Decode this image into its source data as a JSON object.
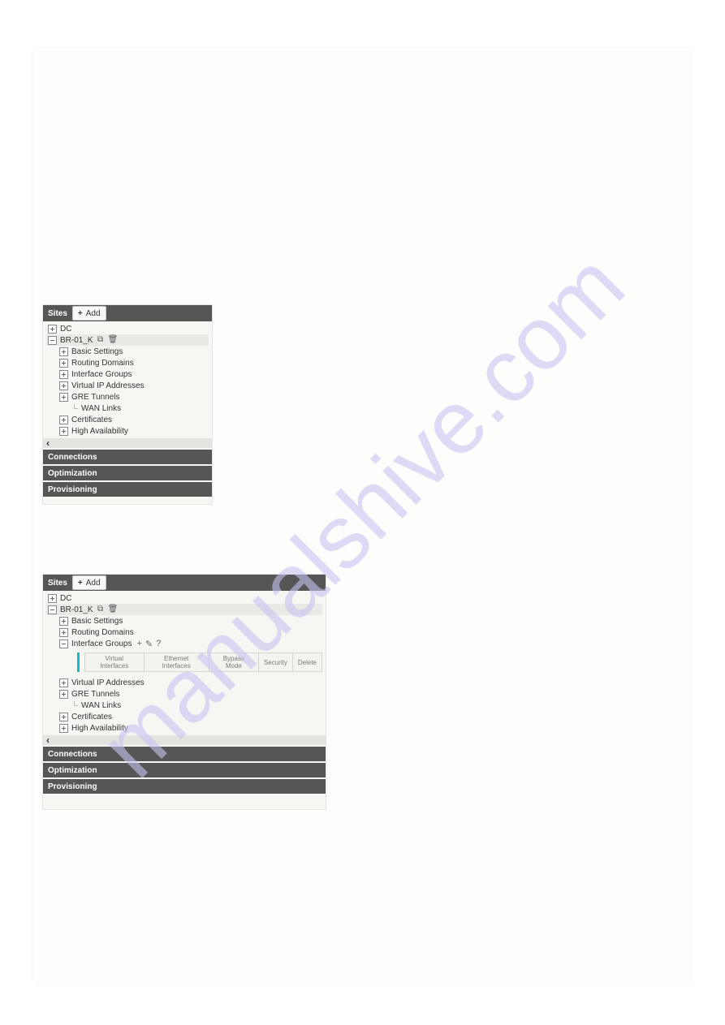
{
  "watermark": "manualshive.com",
  "panel1": {
    "header_label": "Sites",
    "add_button": "Add",
    "tree": {
      "dc": "DC",
      "br": "BR-01_K",
      "basic_settings": "Basic Settings",
      "routing_domains": "Routing Domains",
      "interface_groups": "Interface Groups",
      "virtual_ip": "Virtual IP Addresses",
      "gre_tunnels": "GRE Tunnels",
      "wan_links": "WAN Links",
      "certificates": "Certificates",
      "high_avail": "High Availability"
    },
    "bars": {
      "connections": "Connections",
      "optimization": "Optimization",
      "provisioning": "Provisioning"
    }
  },
  "panel2": {
    "header_label": "Sites",
    "add_button": "Add",
    "tree": {
      "dc": "DC",
      "br": "BR-01_K",
      "basic_settings": "Basic Settings",
      "routing_domains": "Routing Domains",
      "interface_groups": "Interface Groups",
      "virtual_ip": "Virtual IP Addresses",
      "gre_tunnels": "GRE Tunnels",
      "wan_links": "WAN Links",
      "certificates": "Certificates",
      "high_avail": "High Availability"
    },
    "ig_table": {
      "virtual_interfaces": "Virtual Interfaces",
      "ethernet_interfaces": "Ethernet Interfaces",
      "bypass_mode": "Bypass Mode",
      "security": "Security",
      "delete": "Delete"
    },
    "bars": {
      "connections": "Connections",
      "optimization": "Optimization",
      "provisioning": "Provisioning"
    }
  }
}
